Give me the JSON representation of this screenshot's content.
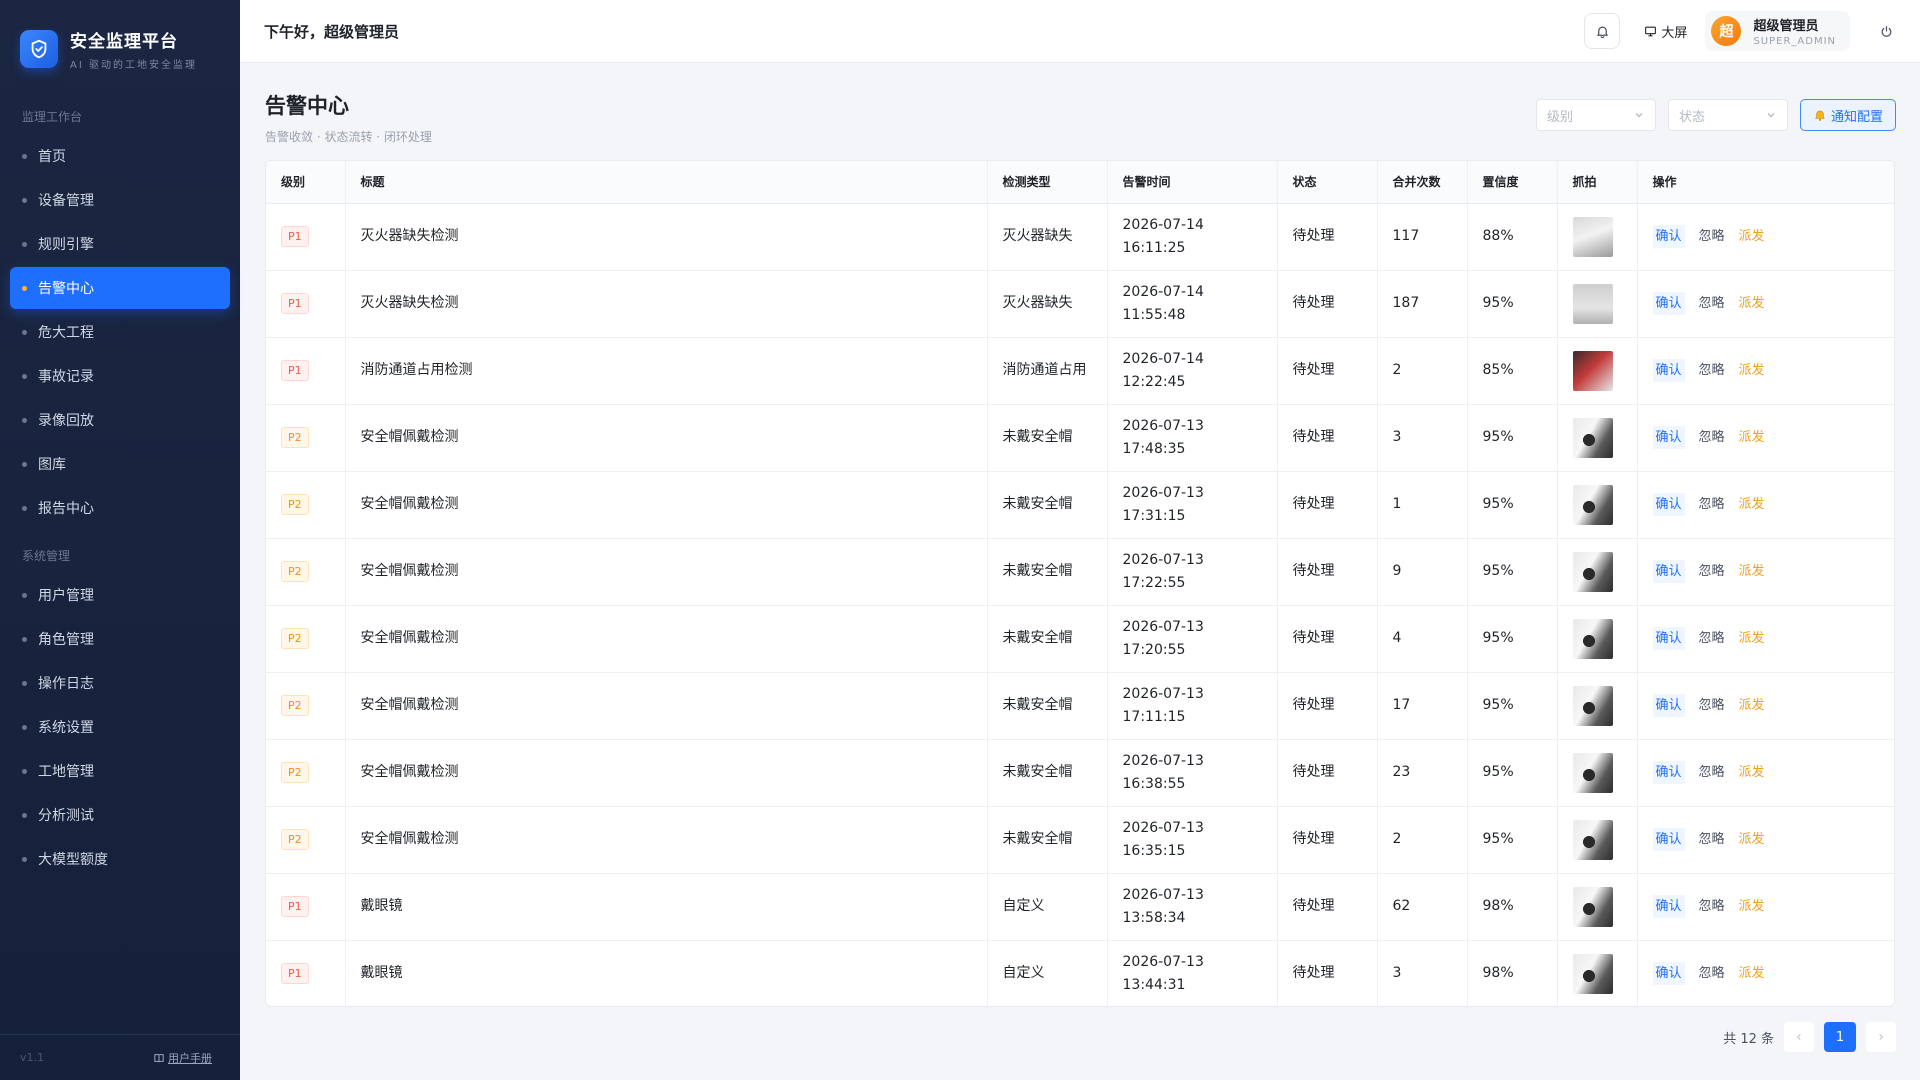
{
  "brand": {
    "title": "安全监理平台",
    "subtitle": "AI 驱动的工地安全监理"
  },
  "sidebar": {
    "section_workbench": "监理工作台",
    "section_system": "系统管理",
    "workbench_items": [
      {
        "label": "首页",
        "active": false
      },
      {
        "label": "设备管理",
        "active": false
      },
      {
        "label": "规则引擎",
        "active": false
      },
      {
        "label": "告警中心",
        "active": true
      },
      {
        "label": "危大工程",
        "active": false
      },
      {
        "label": "事故记录",
        "active": false
      },
      {
        "label": "录像回放",
        "active": false
      },
      {
        "label": "图库",
        "active": false
      },
      {
        "label": "报告中心",
        "active": false
      }
    ],
    "system_items": [
      {
        "label": "用户管理"
      },
      {
        "label": "角色管理"
      },
      {
        "label": "操作日志"
      },
      {
        "label": "系统设置"
      },
      {
        "label": "工地管理"
      },
      {
        "label": "分析测试"
      },
      {
        "label": "大模型额度"
      }
    ],
    "version": "v1.1",
    "manual_label": "用户手册"
  },
  "header": {
    "greeting": "下午好，超级管理员",
    "big_screen_label": "大屏",
    "user_avatar": "超",
    "user_name": "超级管理员",
    "user_role": "SUPER_ADMIN"
  },
  "page": {
    "title": "告警中心",
    "subtitle": "告警收敛 · 状态流转 · 闭环处理",
    "level_placeholder": "级别",
    "status_placeholder": "状态",
    "notify_label": "通知配置"
  },
  "table": {
    "columns": [
      "级别",
      "标题",
      "检测类型",
      "告警时间",
      "状态",
      "合并次数",
      "置信度",
      "抓拍",
      "操作"
    ],
    "actions": {
      "confirm": "确认",
      "ignore": "忽略",
      "assign": "派发"
    },
    "rows": [
      {
        "level": "P1",
        "title": "灭火器缺失检测",
        "type": "灭火器缺失",
        "time": "2026-07-14 16:11:25",
        "status": "待处理",
        "count": "117",
        "confidence": "88%"
      },
      {
        "level": "P1",
        "title": "灭火器缺失检测",
        "type": "灭火器缺失",
        "time": "2026-07-14 11:55:48",
        "status": "待处理",
        "count": "187",
        "confidence": "95%"
      },
      {
        "level": "P1",
        "title": "消防通道占用检测",
        "type": "消防通道占用",
        "time": "2026-07-14 12:22:45",
        "status": "待处理",
        "count": "2",
        "confidence": "85%"
      },
      {
        "level": "P2",
        "title": "安全帽佩戴检测",
        "type": "未戴安全帽",
        "time": "2026-07-13 17:48:35",
        "status": "待处理",
        "count": "3",
        "confidence": "95%"
      },
      {
        "level": "P2",
        "title": "安全帽佩戴检测",
        "type": "未戴安全帽",
        "time": "2026-07-13 17:31:15",
        "status": "待处理",
        "count": "1",
        "confidence": "95%"
      },
      {
        "level": "P2",
        "title": "安全帽佩戴检测",
        "type": "未戴安全帽",
        "time": "2026-07-13 17:22:55",
        "status": "待处理",
        "count": "9",
        "confidence": "95%"
      },
      {
        "level": "P2",
        "title": "安全帽佩戴检测",
        "type": "未戴安全帽",
        "time": "2026-07-13 17:20:55",
        "status": "待处理",
        "count": "4",
        "confidence": "95%"
      },
      {
        "level": "P2",
        "title": "安全帽佩戴检测",
        "type": "未戴安全帽",
        "time": "2026-07-13 17:11:15",
        "status": "待处理",
        "count": "17",
        "confidence": "95%"
      },
      {
        "level": "P2",
        "title": "安全帽佩戴检测",
        "type": "未戴安全帽",
        "time": "2026-07-13 16:38:55",
        "status": "待处理",
        "count": "23",
        "confidence": "95%"
      },
      {
        "level": "P2",
        "title": "安全帽佩戴检测",
        "type": "未戴安全帽",
        "time": "2026-07-13 16:35:15",
        "status": "待处理",
        "count": "2",
        "confidence": "95%"
      },
      {
        "level": "P1",
        "title": "戴眼镜",
        "type": "自定义",
        "time": "2026-07-13 13:58:34",
        "status": "待处理",
        "count": "62",
        "confidence": "98%"
      },
      {
        "level": "P1",
        "title": "戴眼镜",
        "type": "自定义",
        "time": "2026-07-13 13:44:31",
        "status": "待处理",
        "count": "3",
        "confidence": "98%"
      }
    ]
  },
  "pager": {
    "total_label": "共 12 条",
    "current_page": "1"
  },
  "colors": {
    "accent": "#1f6fff",
    "sidebar_bg": "#1b2642",
    "p1": "#f05a4c",
    "p2": "#f09020",
    "assign": "#f0a020"
  },
  "icons": {
    "logo": "shield-check-icon",
    "bell": "bell-icon",
    "screen": "monitor-icon",
    "power": "power-icon",
    "notify": "bell-emoji-icon",
    "manual": "book-icon",
    "select": "chevron-down-icon"
  }
}
